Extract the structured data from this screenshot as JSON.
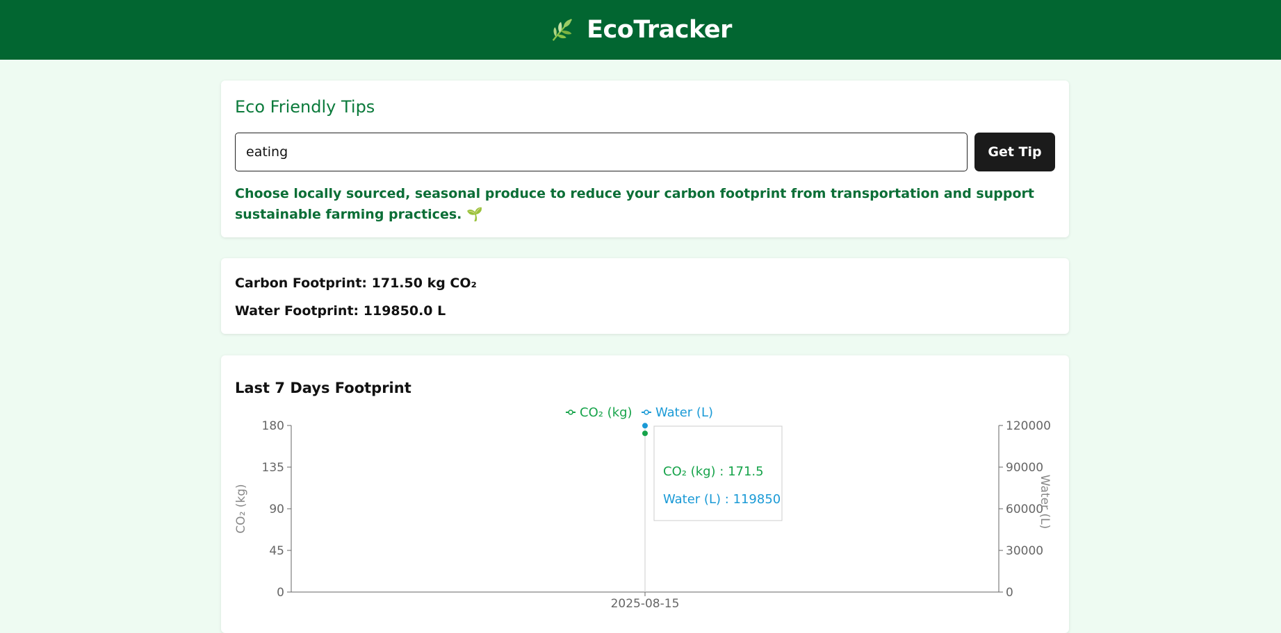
{
  "header": {
    "title": "EcoTracker",
    "logo_icon": "leaf-icon",
    "background": "#026631"
  },
  "tips": {
    "title": "Eco Friendly Tips",
    "input_value": "eating",
    "button_label": "Get Tip",
    "tip_text": "Choose locally sourced, seasonal produce to reduce your carbon footprint from transportation and support sustainable farming practices. 🌱"
  },
  "footprint": {
    "carbon": "Carbon Footprint: 171.50 kg CO₂",
    "water": "Water Footprint: 119850.0 L"
  },
  "chart": {
    "title": "Last 7 Days Footprint"
  },
  "chart_data": {
    "type": "line",
    "x": [
      "2025-08-15"
    ],
    "series": [
      {
        "name": "CO₂ (kg)",
        "axis": "left",
        "values": [
          171.5
        ],
        "color": "#16a34a"
      },
      {
        "name": "Water (L)",
        "axis": "right",
        "values": [
          119850
        ],
        "color": "#1a9ad6"
      }
    ],
    "ylabel_left": "CO₂ (kg)",
    "ylabel_right": "Water (L)",
    "ylim_left": [
      0,
      180
    ],
    "yticks_left": [
      "0",
      "45",
      "90",
      "135",
      "180"
    ],
    "ylim_right": [
      0,
      120000
    ],
    "yticks_right": [
      "0",
      "30000",
      "60000",
      "90000",
      "120000"
    ],
    "legend_position": "top-center",
    "tooltip": {
      "co2": "CO₂ (kg) : 171.5",
      "water": "Water (L) : 119850"
    }
  }
}
